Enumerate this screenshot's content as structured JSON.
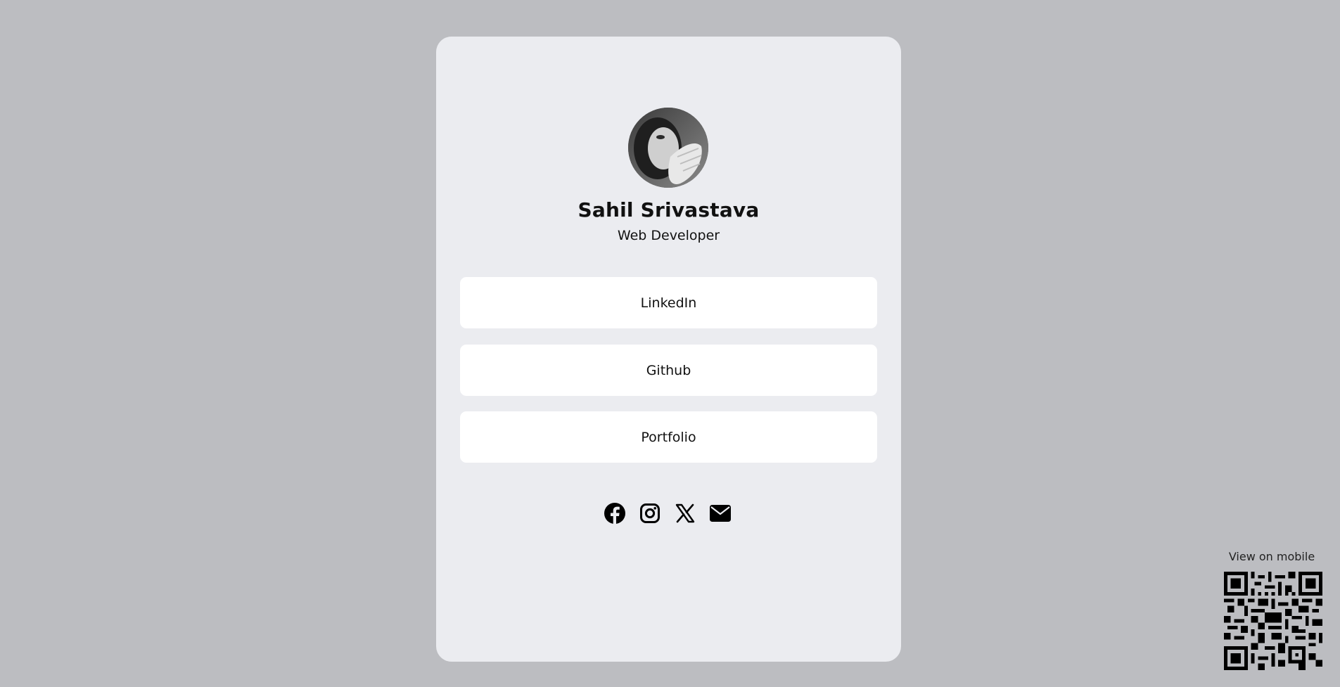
{
  "profile": {
    "name": "Sahil Srivastava",
    "role": "Web Developer"
  },
  "links": [
    {
      "label": "LinkedIn"
    },
    {
      "label": "Github"
    },
    {
      "label": "Portfolio"
    }
  ],
  "socials": [
    {
      "icon": "facebook-icon"
    },
    {
      "icon": "instagram-icon"
    },
    {
      "icon": "x-icon"
    },
    {
      "icon": "mail-icon"
    }
  ],
  "qr": {
    "label": "View on mobile"
  },
  "colors": {
    "page_background": "#bcbdc1",
    "card_background": "#ebecf0",
    "button_background": "#ffffff",
    "text": "#111111"
  }
}
